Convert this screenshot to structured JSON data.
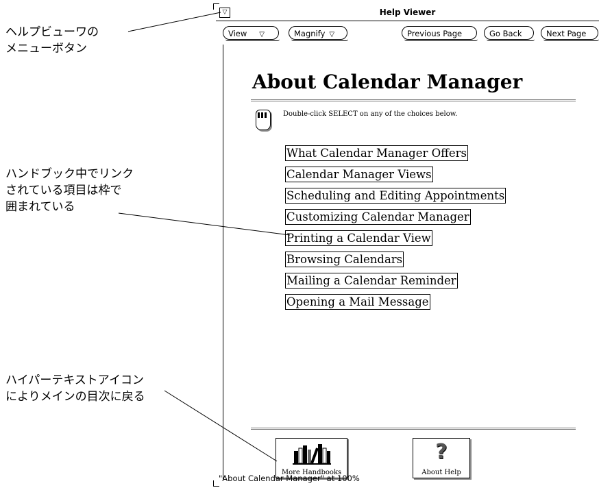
{
  "callouts": {
    "menu_button": "ヘルプビューワの\nメニューボタン",
    "linked_items": "ハンドブック中でリンク\nされている項目は枠で\n囲まれている",
    "hypertext_icon": "ハイパーテキストアイコン\nによりメインの目次に戻る"
  },
  "window": {
    "title": "Help Viewer",
    "menu_icon": "triangle-down-icon",
    "menu_glyph": "▽"
  },
  "controls": {
    "view": "View",
    "magnify": "Magnify",
    "previous_page": "Previous Page",
    "go_back": "Go Back",
    "next_page": "Next Page",
    "menu_arrow": "▽"
  },
  "page": {
    "title": "About Calendar Manager",
    "instruction_icon": "mouse-icon",
    "instruction": "Double-click SELECT on any of the choices below.",
    "links": [
      "What Calendar Manager Offers",
      "Calendar Manager Views",
      "Scheduling and Editing Appointments",
      "Customizing Calendar Manager",
      "Printing a Calendar View",
      "Browsing Calendars",
      "Mailing a Calendar Reminder",
      "Opening a Mail Message"
    ]
  },
  "footer": {
    "more_handbooks": "More Handbooks",
    "more_handbooks_icon": "books-icon",
    "about_help": "About Help",
    "about_help_icon": "question-mark-icon",
    "question_glyph": "?"
  },
  "status": "\"About Calendar Manager\" at 100%"
}
